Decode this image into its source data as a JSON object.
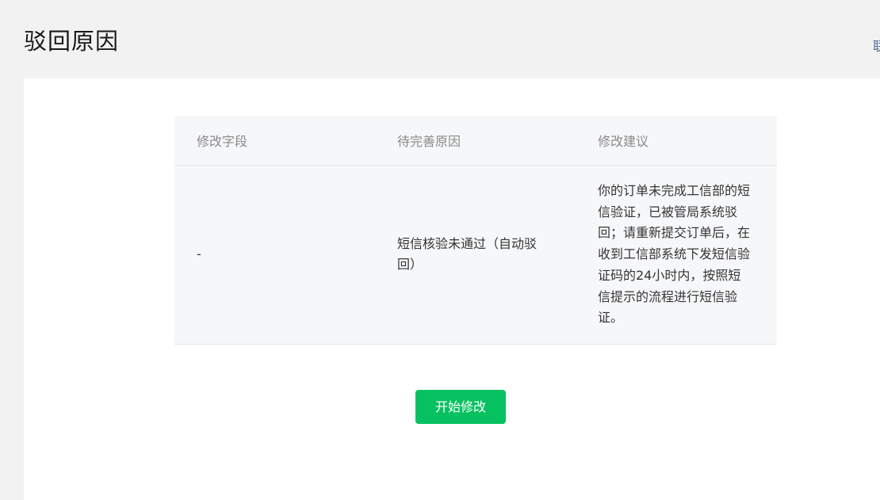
{
  "header": {
    "title": "驳回原因",
    "link_text": "联"
  },
  "table": {
    "columns": [
      "修改字段",
      "待完善原因",
      "修改建议"
    ],
    "rows": [
      {
        "field": "-",
        "reason": "短信核验未通过（自动驳回）",
        "suggestion": "你的订单未完成工信部的短信验证，已被管局系统驳回；请重新提交订单后，在收到工信部系统下发短信验证码的24小时内，按照短信提示的流程进行短信验证。"
      }
    ]
  },
  "actions": {
    "start_label": "开始修改"
  },
  "colors": {
    "primary_button": "#07c160",
    "page_background": "#f2f2f2",
    "table_background": "#f6f7f9",
    "link": "#576b95"
  }
}
